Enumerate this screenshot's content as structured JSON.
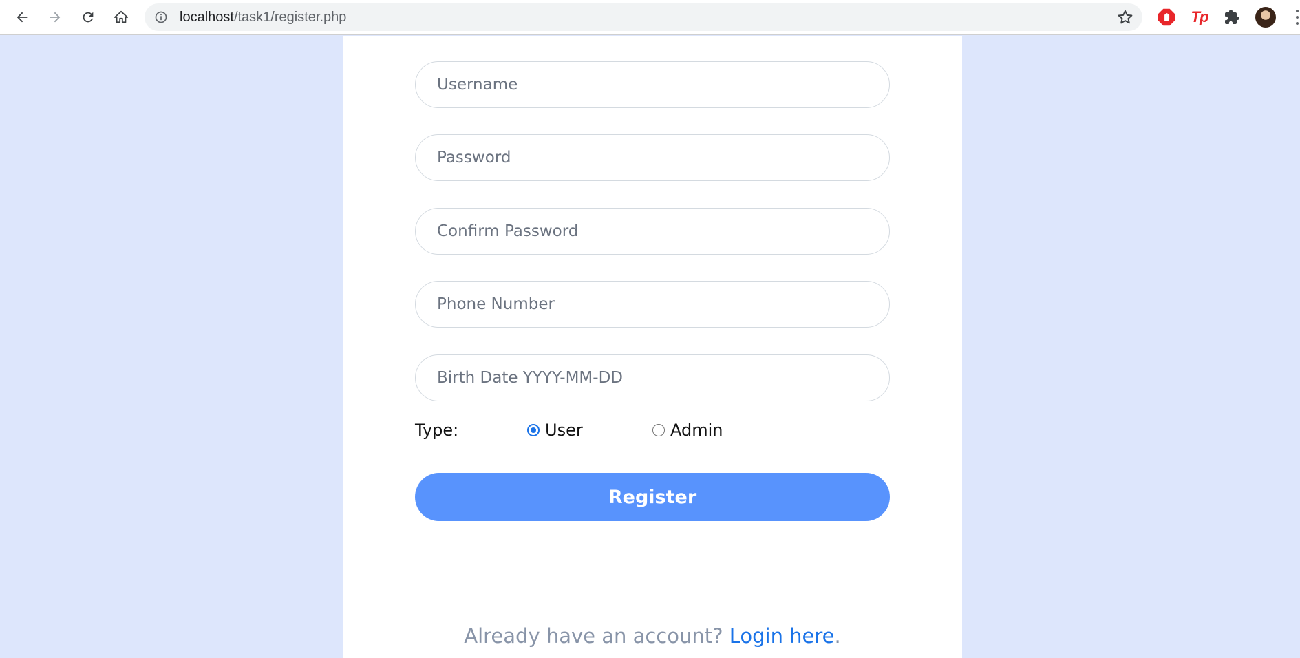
{
  "browser": {
    "url_host": "localhost",
    "url_path": "/task1/register.php"
  },
  "form": {
    "username_placeholder": "Username",
    "password_placeholder": "Password",
    "confirm_password_placeholder": "Confirm Password",
    "phone_placeholder": "Phone Number",
    "birthdate_placeholder": "Birth Date YYYY-MM-DD",
    "type_label": "Type:",
    "type_options": [
      "User",
      "Admin"
    ],
    "type_selected": "User",
    "register_label": "Register"
  },
  "footer": {
    "prompt": "Already have an account? ",
    "link_text": "Login here",
    "period": "."
  },
  "colors": {
    "page_background": "#dde6fc",
    "button": "#5893fd",
    "link": "#1a73e8"
  },
  "icons": [
    "back-arrow-icon",
    "forward-arrow-icon",
    "reload-icon",
    "home-icon",
    "info-icon",
    "star-icon",
    "adblock-stop-icon",
    "tp-extension-icon",
    "puzzle-extensions-icon",
    "profile-avatar",
    "menu-kebab-icon"
  ]
}
